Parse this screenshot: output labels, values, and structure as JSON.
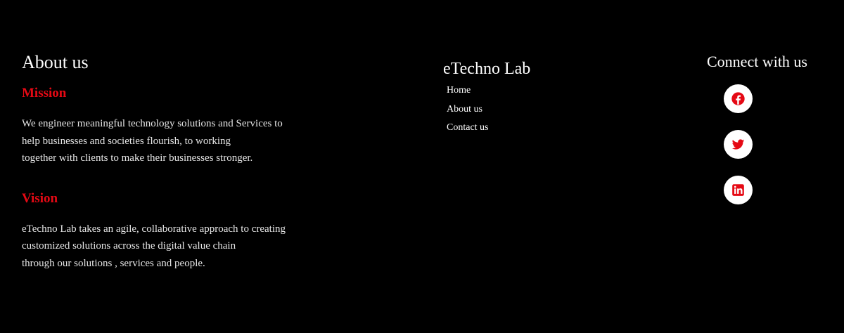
{
  "colors": {
    "background": "#000000",
    "accent": "#e50914",
    "text": "#ffffff"
  },
  "about": {
    "title": "About us",
    "mission": {
      "heading": "Mission",
      "lines": [
        "We engineer meaningful technology solutions and Services to",
        "help businesses and societies flourish, to working",
        "together with clients to make their businesses stronger."
      ]
    },
    "vision": {
      "heading": "Vision",
      "lines": [
        "eTechno Lab takes an agile, collaborative approach to creating",
        "customized solutions across the digital value chain",
        "through our solutions , services and people."
      ]
    }
  },
  "brand": {
    "title": "eTechno Lab",
    "links": [
      "Home",
      "About us",
      "Contact us"
    ]
  },
  "connect": {
    "title": "Connect with us",
    "icons": [
      "facebook-icon",
      "twitter-icon",
      "linkedin-icon"
    ]
  }
}
